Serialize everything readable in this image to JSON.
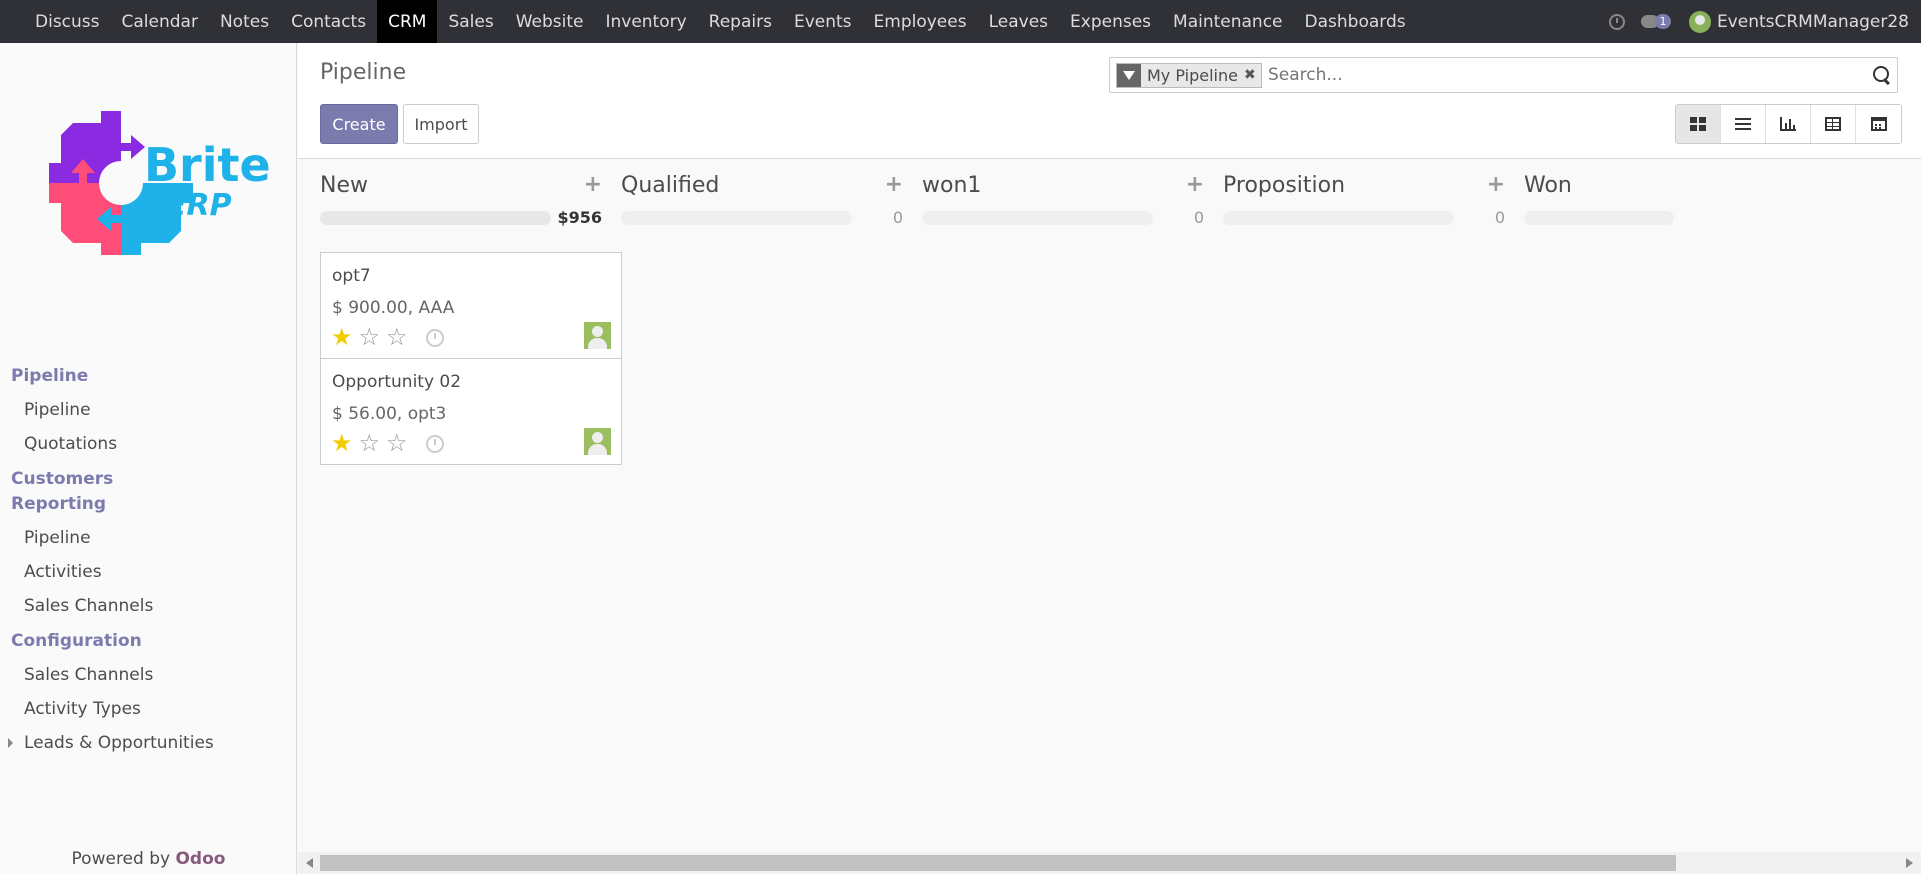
{
  "topnav": {
    "apps": [
      "Discuss",
      "Calendar",
      "Notes",
      "Contacts",
      "CRM",
      "Sales",
      "Website",
      "Inventory",
      "Repairs",
      "Events",
      "Employees",
      "Leaves",
      "Expenses",
      "Maintenance",
      "Dashboards"
    ],
    "active_app": "CRM",
    "message_count": "1",
    "user_name": "EventsCRMManager28"
  },
  "logo": {
    "text1": "Brite",
    "text2": "ERP"
  },
  "sidebar": {
    "sections": [
      {
        "title": "Pipeline",
        "items": [
          "Pipeline",
          "Quotations"
        ]
      },
      {
        "title": "Customers",
        "items": []
      },
      {
        "title": "Reporting",
        "items": [
          "Pipeline",
          "Activities",
          "Sales Channels"
        ]
      },
      {
        "title": "Configuration",
        "items": [
          "Sales Channels",
          "Activity Types",
          "Leads & Opportunities"
        ]
      }
    ],
    "powered_prefix": "Powered by ",
    "powered_brand": "Odoo"
  },
  "control": {
    "title": "Pipeline",
    "create_label": "Create",
    "import_label": "Import",
    "facet_label": "My Pipeline",
    "search_placeholder": "Search..."
  },
  "views": [
    "kanban-view-icon",
    "list-view-icon",
    "graph-view-icon",
    "pivot-view-icon",
    "calendar-view-icon"
  ],
  "columns": [
    {
      "title": "New",
      "total": "$956",
      "cards": [
        {
          "name": "opt7",
          "amount": "$ 900.00, AAA",
          "priority": 1
        },
        {
          "name": "Opportunity 02",
          "amount": "$ 56.00, opt3",
          "priority": 1
        }
      ]
    },
    {
      "title": "Qualified",
      "total": "0",
      "cards": []
    },
    {
      "title": "won1",
      "total": "0",
      "cards": []
    },
    {
      "title": "Proposition",
      "total": "0",
      "cards": []
    },
    {
      "title": "Won",
      "total": "",
      "cards": []
    }
  ],
  "colors": {
    "accent": "#7c7bad",
    "topbar": "#2f3136",
    "star": "#f3cc00"
  }
}
